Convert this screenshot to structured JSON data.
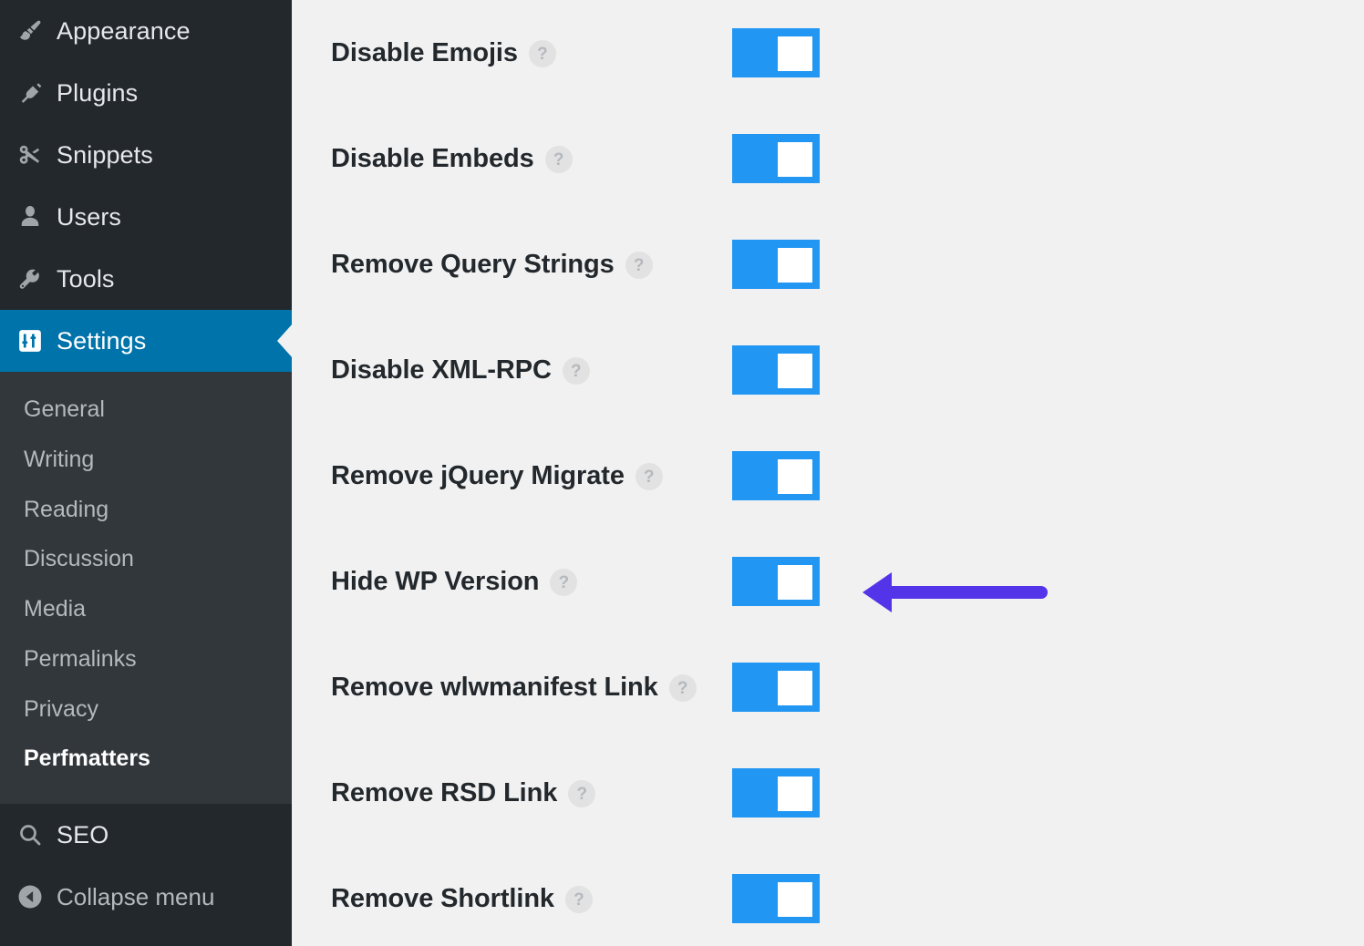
{
  "sidebar": {
    "menu_items": [
      {
        "label": "Appearance",
        "icon": "paintbrush-icon",
        "active": false
      },
      {
        "label": "Plugins",
        "icon": "plug-icon",
        "active": false
      },
      {
        "label": "Snippets",
        "icon": "scissors-icon",
        "active": false
      },
      {
        "label": "Users",
        "icon": "user-icon",
        "active": false
      },
      {
        "label": "Tools",
        "icon": "wrench-icon",
        "active": false
      },
      {
        "label": "Settings",
        "icon": "sliders-icon",
        "active": true
      }
    ],
    "submenu_items": [
      {
        "label": "General",
        "current": false
      },
      {
        "label": "Writing",
        "current": false
      },
      {
        "label": "Reading",
        "current": false
      },
      {
        "label": "Discussion",
        "current": false
      },
      {
        "label": "Media",
        "current": false
      },
      {
        "label": "Permalinks",
        "current": false
      },
      {
        "label": "Privacy",
        "current": false
      },
      {
        "label": "Perfmatters",
        "current": true
      }
    ],
    "seo_item": {
      "label": "SEO",
      "icon": "search-icon"
    },
    "collapse_item": {
      "label": "Collapse menu",
      "icon": "collapse-left-icon"
    },
    "colors": {
      "background": "#23282d",
      "submenu_background": "#32373c",
      "active_background": "#0073aa",
      "label": "#e6e8ea",
      "submenu_label": "#b4b9be"
    }
  },
  "main": {
    "help_glyph": "?",
    "settings": [
      {
        "label": "Disable Emojis",
        "enabled": true
      },
      {
        "label": "Disable Embeds",
        "enabled": true
      },
      {
        "label": "Remove Query Strings",
        "enabled": true
      },
      {
        "label": "Disable XML-RPC",
        "enabled": true
      },
      {
        "label": "Remove jQuery Migrate",
        "enabled": true
      },
      {
        "label": "Hide WP Version",
        "enabled": true
      },
      {
        "label": "Remove wlwmanifest Link",
        "enabled": true
      },
      {
        "label": "Remove RSD Link",
        "enabled": true
      },
      {
        "label": "Remove Shortlink",
        "enabled": true
      }
    ],
    "colors": {
      "background": "#f1f1f1",
      "toggle_on": "#2196f3",
      "toggle_knob": "#ffffff",
      "label": "#23282d",
      "help_circle": "#e2e2e2"
    }
  },
  "annotation": {
    "type": "left-arrow",
    "points_to": "Hide WP Version",
    "color": "#5434e8"
  }
}
